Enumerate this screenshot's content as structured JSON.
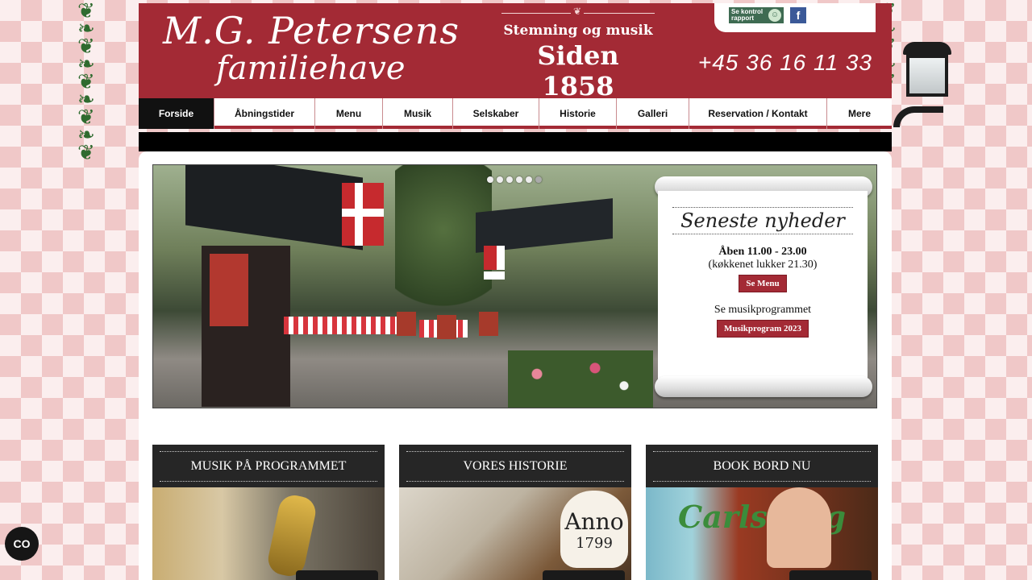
{
  "header": {
    "logo_line1": "M.G. Petersens",
    "logo_line2": "familiehave",
    "tagline_small": "Stemning og musik",
    "tagline_big": "Siden 1858",
    "phone": "+45 36 16 11 33",
    "kontrol_label": "Se kontrol rapport",
    "facebook_label": "f"
  },
  "nav": {
    "items": [
      {
        "label": "Forside"
      },
      {
        "label": "Åbningstider"
      },
      {
        "label": "Menu"
      },
      {
        "label": "Musik"
      },
      {
        "label": "Selskaber"
      },
      {
        "label": "Historie"
      },
      {
        "label": "Galleri"
      },
      {
        "label": "Reservation / Kontakt"
      },
      {
        "label": "Mere"
      }
    ],
    "active_index": 0
  },
  "slider": {
    "dot_count": 5,
    "active_dot": 4,
    "news_title": "Seneste nyheder",
    "open_hours": "Åben 11.00 - 23.00",
    "kitchen_note": "(køkkenet lukker 21.30)",
    "menu_button": "Se Menu",
    "music_line": "Se musikprogrammet",
    "music_button": "Musikprogram 2023"
  },
  "boxes": [
    {
      "title": "MUSIK PÅ PROGRAMMET"
    },
    {
      "title": "VORES HISTORIE",
      "image_text_1": "Anno",
      "image_text_2": "1799"
    },
    {
      "title": "BOOK BORD NU",
      "image_text": "Carlsberg"
    }
  ],
  "accessibility_label": "CO",
  "colors": {
    "brand_red": "#a32a35",
    "dark": "#262626"
  }
}
